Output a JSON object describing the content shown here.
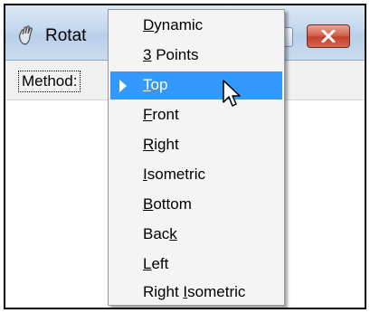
{
  "window": {
    "title": "Rotat",
    "method_label": "Method:"
  },
  "menu": {
    "items": [
      {
        "before": "",
        "mnemonic": "D",
        "after": "ynamic"
      },
      {
        "before": "",
        "mnemonic": "3",
        "after": " Points"
      },
      {
        "before": "",
        "mnemonic": "T",
        "after": "op",
        "selected": true
      },
      {
        "before": "",
        "mnemonic": "F",
        "after": "ront"
      },
      {
        "before": "",
        "mnemonic": "R",
        "after": "ight"
      },
      {
        "before": "",
        "mnemonic": "I",
        "after": "sometric"
      },
      {
        "before": "",
        "mnemonic": "B",
        "after": "ottom"
      },
      {
        "before": "Bac",
        "mnemonic": "k",
        "after": ""
      },
      {
        "before": "",
        "mnemonic": "L",
        "after": "eft"
      },
      {
        "before": "Right ",
        "mnemonic": "I",
        "after": "sometric"
      }
    ]
  },
  "colors": {
    "selection": "#3399ff",
    "close_button": "#c1402b"
  },
  "icons": {
    "app": "hand-icon",
    "selected_marker": "triangle-right-icon",
    "pointer": "arrow-cursor-icon"
  }
}
